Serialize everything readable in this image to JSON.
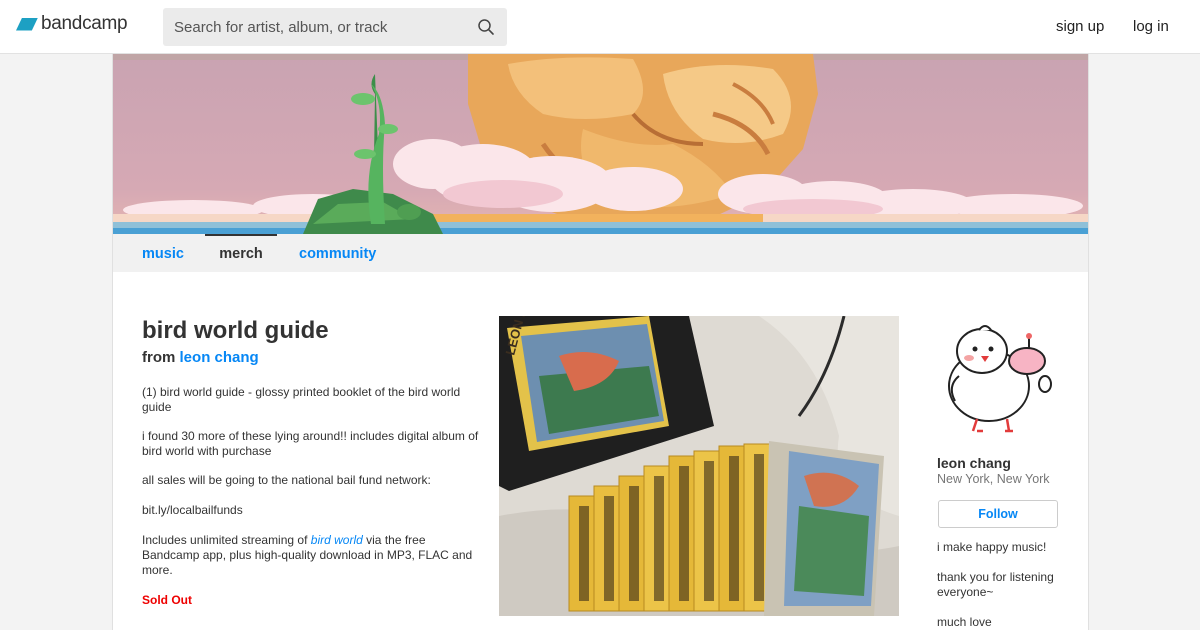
{
  "header": {
    "logo_text": "bandcamp",
    "search_placeholder": "Search for artist, album, or track",
    "signup_label": "sign up",
    "login_label": "log in",
    "accent_color": "#1da0c3"
  },
  "nav": {
    "tabs": [
      {
        "label": "music",
        "active": false
      },
      {
        "label": "merch",
        "active": true
      },
      {
        "label": "community",
        "active": false
      }
    ]
  },
  "item": {
    "title": "bird world guide",
    "from_label": "from",
    "artist": "leon chang",
    "description": [
      "(1) bird world guide - glossy printed booklet of the bird world guide",
      "i found 30 more of these lying around!! includes digital album of bird world with purchase",
      "all sales will be going to the national bail fund network:",
      "bit.ly/localbailfunds"
    ],
    "streaming_prefix": "Includes unlimited streaming of",
    "streaming_album": "bird world",
    "streaming_suffix": "via the free Bandcamp app, plus high-quality download in MP3, FLAC and more.",
    "status": "Sold Out",
    "photo_text": "LEON BIRD WORLD"
  },
  "sidebar": {
    "artist": "leon chang",
    "location": "New York, New York",
    "follow_label": "Follow",
    "bio": [
      "i make happy music!",
      "thank you for listening everyone~",
      "much love"
    ]
  },
  "colors": {
    "link": "#0687f5",
    "sold_out": "#ee0000",
    "nav_bg": "#f1f1f1"
  }
}
